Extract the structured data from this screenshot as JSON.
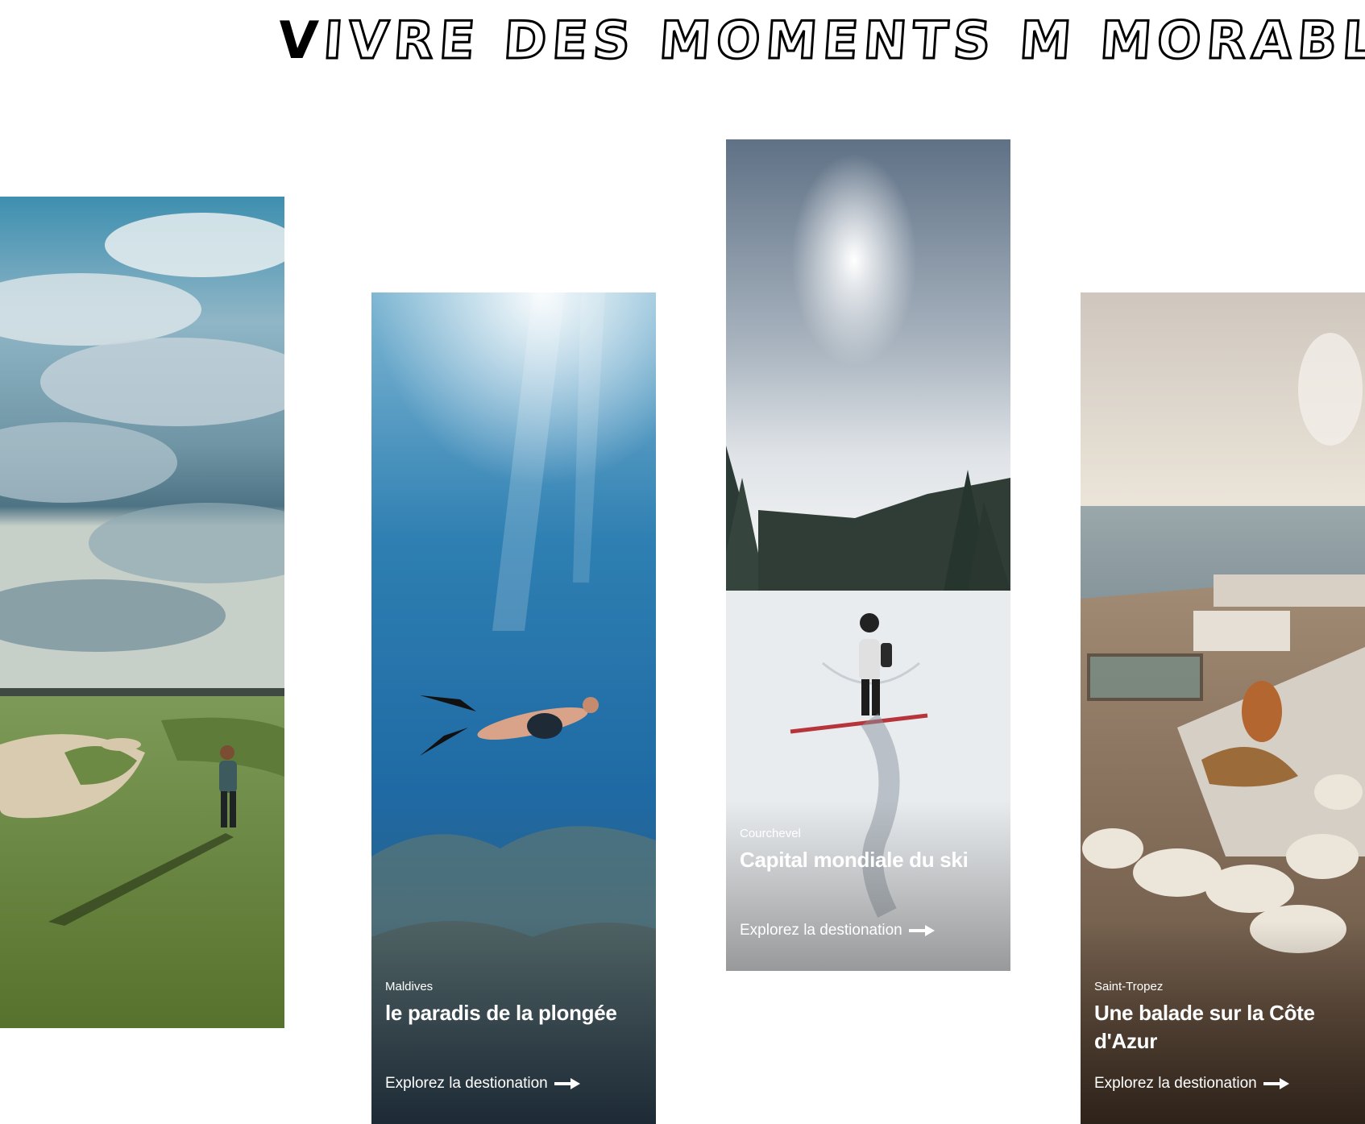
{
  "title": {
    "first_letter": "V",
    "rest": "ivre des moments m morables"
  },
  "cards": [
    {
      "scene": "golf course under cloudy sky"
    },
    {
      "scene": "snorkeler over coral reef",
      "location": "Maldives",
      "headline": "le paradis de la plongée",
      "cta": "Explorez la destionation"
    },
    {
      "scene": "skier on snowy mountain slope",
      "location": "Courchevel",
      "headline": "Capital mondiale du ski",
      "cta": "Explorez la destionation"
    },
    {
      "scene": "woman lounging on sea-view terrace",
      "location": "Saint-Tropez",
      "headline": "Une balade sur la Côte d'Azur",
      "cta": "Explorez la destionation"
    }
  ],
  "icons": {
    "cta_arrow": "arrow-right-icon"
  },
  "colors": {
    "background": "#ffffff",
    "title_stroke": "#000000",
    "overlay_text": "#ffffff"
  }
}
